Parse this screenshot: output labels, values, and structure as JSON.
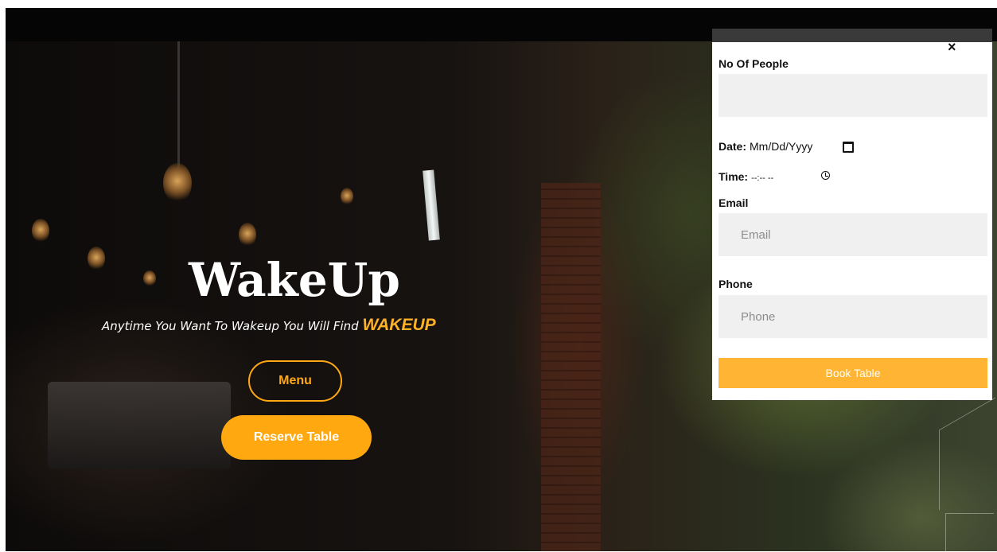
{
  "hero": {
    "title": "WakeUp",
    "tagline": "Anytime You Want To Wakeup You Will Find",
    "tagline_accent": "WAKEUP",
    "menu_button": "Menu",
    "reserve_button": "Reserve Table"
  },
  "booking": {
    "close_icon": "×",
    "people_label": "No Of People",
    "people_value": "",
    "date_label": "Date:",
    "date_placeholder": "Mm/Dd/Yyyy",
    "time_label": "Time:",
    "time_placeholder": "--:-- --",
    "email_label": "Email",
    "email_placeholder": "Email",
    "phone_label": "Phone",
    "phone_placeholder": "Phone",
    "submit_label": "Book Table"
  },
  "colors": {
    "accent": "#ffa812",
    "book_button": "#ffb533",
    "field_bg": "#f0f0f0"
  }
}
